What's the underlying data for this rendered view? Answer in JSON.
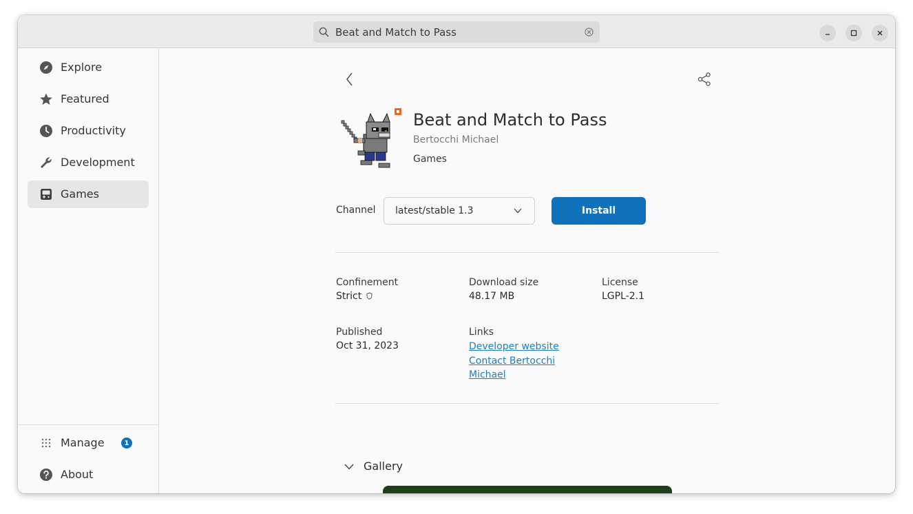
{
  "search": {
    "value": "Beat and Match to Pass"
  },
  "window_controls": {
    "minimize": "minimize-icon",
    "maximize": "maximize-icon",
    "close": "close-icon"
  },
  "sidebar": {
    "items": [
      {
        "label": "Explore",
        "icon": "compass-icon",
        "active": false
      },
      {
        "label": "Featured",
        "icon": "star-icon",
        "active": false
      },
      {
        "label": "Productivity",
        "icon": "clock-icon",
        "active": false
      },
      {
        "label": "Development",
        "icon": "wrench-icon",
        "active": false
      },
      {
        "label": "Games",
        "icon": "gamepad-icon",
        "active": true
      }
    ],
    "bottom": [
      {
        "label": "Manage",
        "icon": "grid-icon",
        "badge": "1"
      },
      {
        "label": "About",
        "icon": "help-icon"
      }
    ]
  },
  "app": {
    "title": "Beat and Match to Pass",
    "developer": "Bertocchi Michael",
    "category": "Games"
  },
  "channel": {
    "label": "Channel",
    "selected": "latest/stable 1.3",
    "install_label": "Install"
  },
  "details": {
    "confinement_label": "Confinement",
    "confinement_value": "Strict",
    "download_label": "Download size",
    "download_value": "48.17 MB",
    "license_label": "License",
    "license_value": "LGPL-2.1",
    "published_label": "Published",
    "published_value": "Oct 31, 2023",
    "links_label": "Links",
    "links": [
      "Developer website",
      "Contact Bertocchi",
      "Michael"
    ]
  },
  "gallery": {
    "label": "Gallery"
  },
  "colors": {
    "accent": "#0e72bd",
    "link": "#1d80c5",
    "badge": "#0e72bd"
  }
}
